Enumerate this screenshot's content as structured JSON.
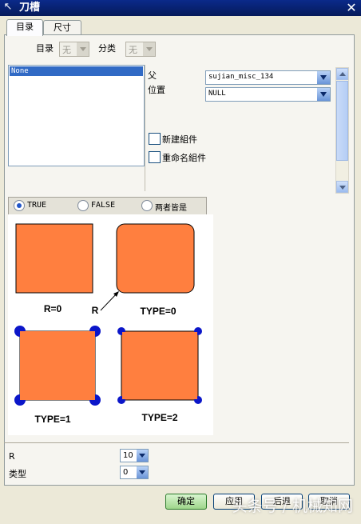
{
  "window": {
    "title": "刀槽",
    "close_glyph": "✕"
  },
  "tabs": [
    {
      "label": "目录"
    },
    {
      "label": "尺寸"
    }
  ],
  "catalog": {
    "label": "目录",
    "value": "无"
  },
  "category": {
    "label": "分类",
    "value": "无"
  },
  "list": {
    "items": [
      "None"
    ]
  },
  "parent": {
    "label": "父",
    "value": "sujian_misc_134"
  },
  "position": {
    "label": "位置",
    "value": "NULL"
  },
  "checkboxes": [
    {
      "label": "新建組件",
      "checked": false
    },
    {
      "label": "重命名組件",
      "checked": false
    }
  ],
  "radios": [
    {
      "label": "TRUE",
      "selected": true
    },
    {
      "label": "FALSE",
      "selected": false
    },
    {
      "label": "两者皆是",
      "selected": false
    }
  ],
  "diagram": {
    "labels": {
      "r0": "R=0",
      "r": "R",
      "type0": "TYPE=0",
      "type1": "TYPE=1",
      "type2": "TYPE=2"
    },
    "colors": {
      "fill": "#ff7f3f",
      "corner": "#0b16c9"
    }
  },
  "fields": [
    {
      "label": "R",
      "value": "10"
    },
    {
      "label": "类型",
      "value": "0"
    }
  ],
  "buttons": {
    "ok": "确定",
    "apply": "应用",
    "back": "后退",
    "cancel": "取消"
  },
  "watermark": "头条号 / 机械知网"
}
